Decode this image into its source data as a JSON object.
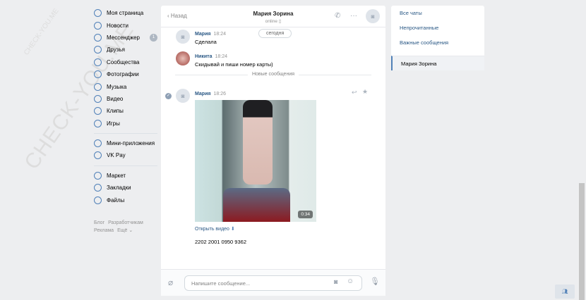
{
  "watermark": "CHECK-YOU.ME",
  "nav": {
    "items": [
      {
        "label": "Моя страница",
        "icon": "user-icon"
      },
      {
        "label": "Новости",
        "icon": "news-icon"
      },
      {
        "label": "Мессенджер",
        "icon": "message-icon",
        "badge": "1"
      },
      {
        "label": "Друзья",
        "icon": "friends-icon"
      },
      {
        "label": "Сообщества",
        "icon": "groups-icon"
      },
      {
        "label": "Фотографии",
        "icon": "photo-icon"
      },
      {
        "label": "Музыка",
        "icon": "music-icon"
      },
      {
        "label": "Видео",
        "icon": "video-icon"
      },
      {
        "label": "Клипы",
        "icon": "clips-icon"
      },
      {
        "label": "Игры",
        "icon": "games-icon"
      }
    ],
    "items2": [
      {
        "label": "Мини-приложения",
        "icon": "apps-icon"
      },
      {
        "label": "VK Pay",
        "icon": "vkpay-icon"
      }
    ],
    "items3": [
      {
        "label": "Маркет",
        "icon": "market-icon"
      },
      {
        "label": "Закладки",
        "icon": "bookmark-icon"
      },
      {
        "label": "Файлы",
        "icon": "file-icon"
      }
    ],
    "footer": [
      "Блог",
      "Разработчикам",
      "Реклама",
      "Ещё ⌄"
    ]
  },
  "chat": {
    "back": "Назад",
    "title": "Мария Зорина",
    "status": "online ▯",
    "date_pill": "сегодня",
    "messages": [
      {
        "name": "Мария",
        "time": "18:24",
        "text": "Сделала"
      },
      {
        "name": "Никита",
        "time": "18:24",
        "text": "Скидывай и пиши номер карты)"
      }
    ],
    "new_divider": "Новые сообщения",
    "last": {
      "name": "Мария",
      "time": "18:26",
      "video_duration": "0:34",
      "open_video": "Открыть видео",
      "text": "2202 2001 0950 9362"
    },
    "placeholder": "Напишите сообщение..."
  },
  "right": {
    "items": [
      "Все чаты",
      "Непрочитанные",
      "Важные сообщения"
    ],
    "active": "Мария Зорина"
  },
  "colors": {
    "accent": "#5181b8",
    "link": "#2a5885",
    "bg": "#edeef0"
  }
}
